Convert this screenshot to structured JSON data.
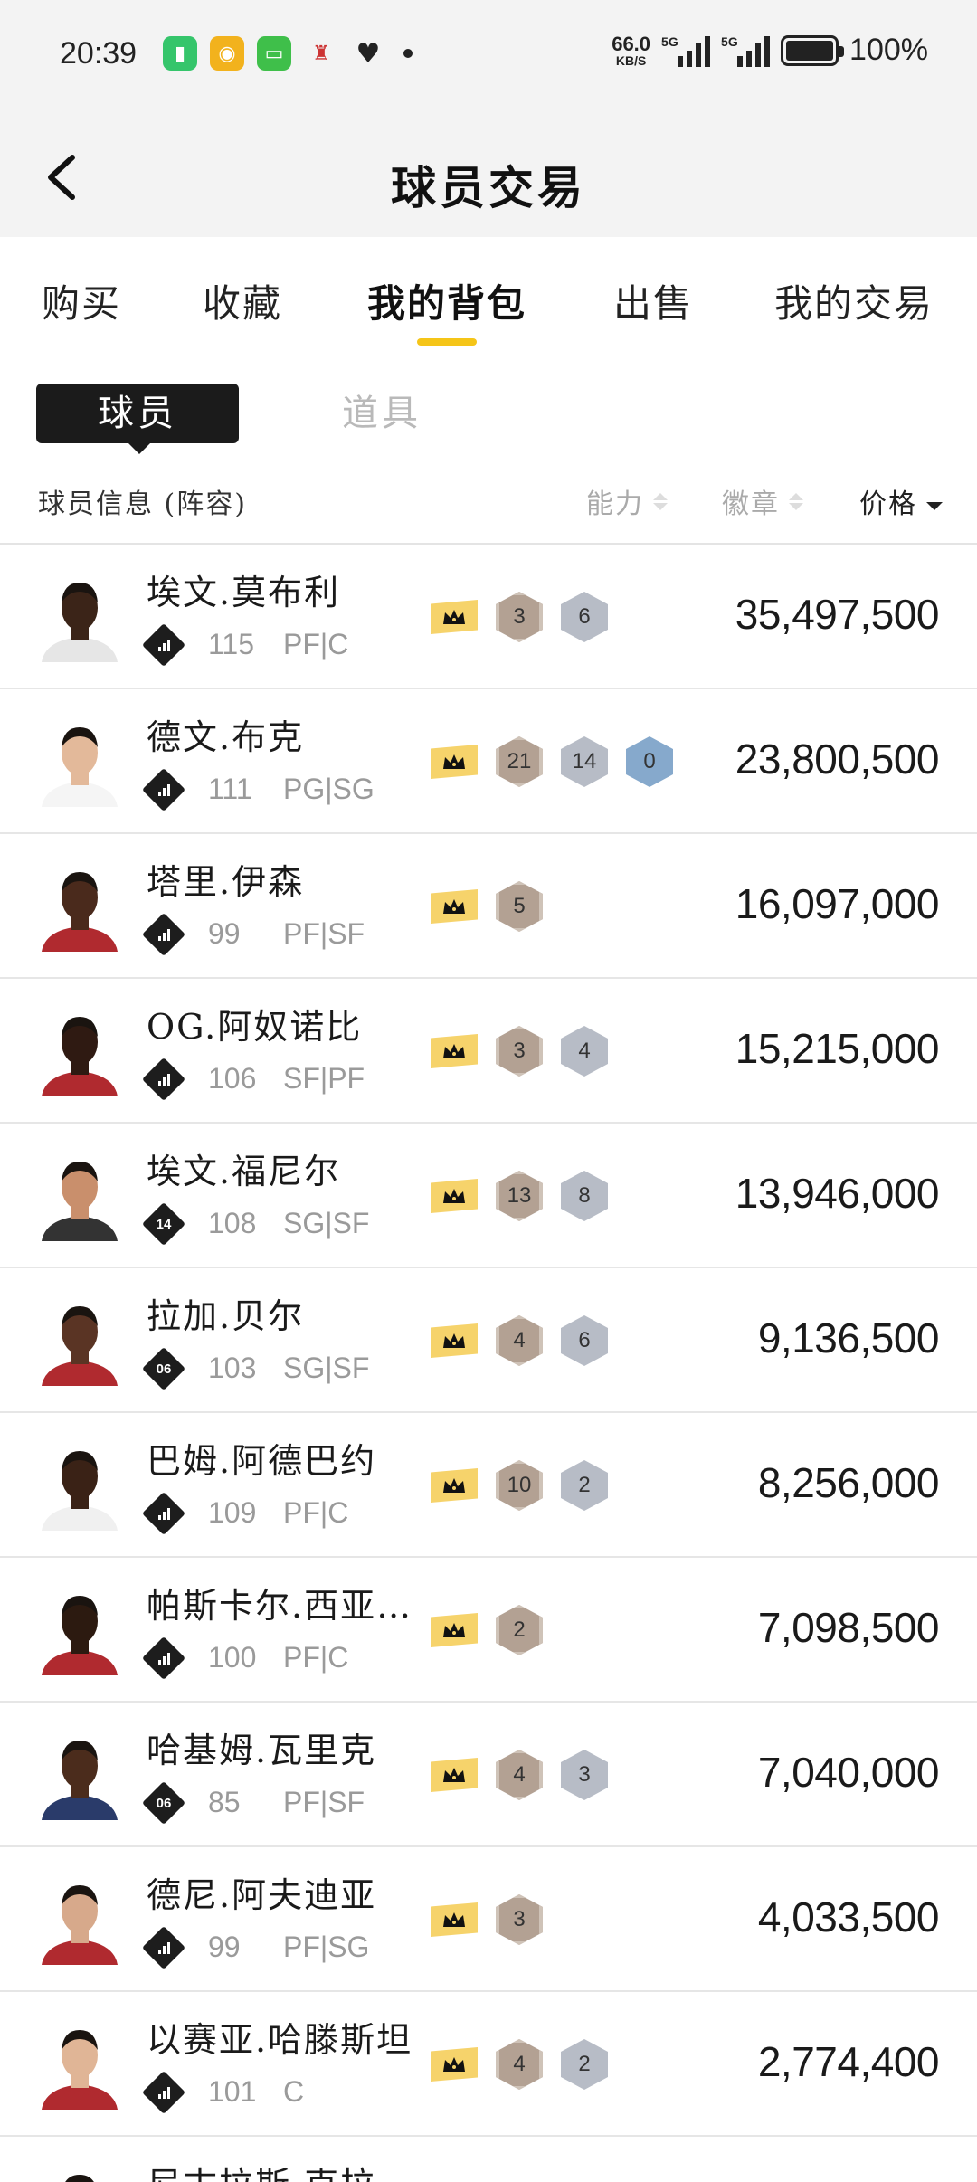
{
  "status_bar": {
    "time": "20:39",
    "net_speed_value": "66.0",
    "net_speed_unit": "KB/S",
    "signal_tag_1": "5G",
    "signal_tag_2": "5G",
    "battery_text": "100%",
    "app_icons": [
      "battery-app-icon",
      "weibo-icon",
      "message-icon",
      "app-icon",
      "heart-icon"
    ]
  },
  "header": {
    "title": "球员交易",
    "back_icon": "chevron-left-icon"
  },
  "main_tabs": [
    "购买",
    "收藏",
    "我的背包",
    "出售",
    "我的交易"
  ],
  "active_main_tab": "我的背包",
  "sub_tabs": {
    "active": "球员",
    "other": "道具"
  },
  "columns": {
    "info": "球员信息 (阵容)",
    "ability": "能力",
    "badges": "徽章",
    "price": "价格"
  },
  "accent_color": "#f5c518",
  "players": [
    {
      "name": "埃文.莫布利",
      "rating": "115",
      "position": "PF|C",
      "level_icon": "bars",
      "badges": [
        "3",
        "6"
      ],
      "price": "35,497,500"
    },
    {
      "name": "德文.布克",
      "rating": "111",
      "position": "PG|SG",
      "level_icon": "bars",
      "badges": [
        "21",
        "14",
        "0"
      ],
      "price": "23,800,500"
    },
    {
      "name": "塔里.伊森",
      "rating": "99",
      "position": "PF|SF",
      "level_icon": "bars",
      "badges": [
        "5"
      ],
      "price": "16,097,000"
    },
    {
      "name": "OG.阿奴诺比",
      "rating": "106",
      "position": "SF|PF",
      "level_icon": "bars",
      "badges": [
        "3",
        "4"
      ],
      "price": "15,215,000"
    },
    {
      "name": "埃文.福尼尔",
      "rating": "108",
      "position": "SG|SF",
      "level_icon": "14",
      "badges": [
        "13",
        "8"
      ],
      "price": "13,946,000"
    },
    {
      "name": "拉加.贝尔",
      "rating": "103",
      "position": "SG|SF",
      "level_icon": "06",
      "badges": [
        "4",
        "6"
      ],
      "price": "9,136,500"
    },
    {
      "name": "巴姆.阿德巴约",
      "rating": "109",
      "position": "PF|C",
      "level_icon": "bars",
      "badges": [
        "10",
        "2"
      ],
      "price": "8,256,000"
    },
    {
      "name": "帕斯卡尔.西亚…",
      "rating": "100",
      "position": "PF|C",
      "level_icon": "bars",
      "badges": [
        "2"
      ],
      "price": "7,098,500"
    },
    {
      "name": "哈基姆.瓦里克",
      "rating": "85",
      "position": "PF|SF",
      "level_icon": "06",
      "badges": [
        "4",
        "3"
      ],
      "price": "7,040,000"
    },
    {
      "name": "德尼.阿夫迪亚",
      "rating": "99",
      "position": "PF|SG",
      "level_icon": "bars",
      "badges": [
        "3"
      ],
      "price": "4,033,500"
    },
    {
      "name": "以赛亚.哈滕斯坦",
      "rating": "101",
      "position": "C",
      "level_icon": "bars",
      "badges": [
        "4",
        "2"
      ],
      "price": "2,774,400"
    },
    {
      "name": "尼古拉斯.克拉…",
      "rating": "",
      "position": "",
      "level_icon": "bars",
      "badges": [],
      "price": ""
    }
  ]
}
